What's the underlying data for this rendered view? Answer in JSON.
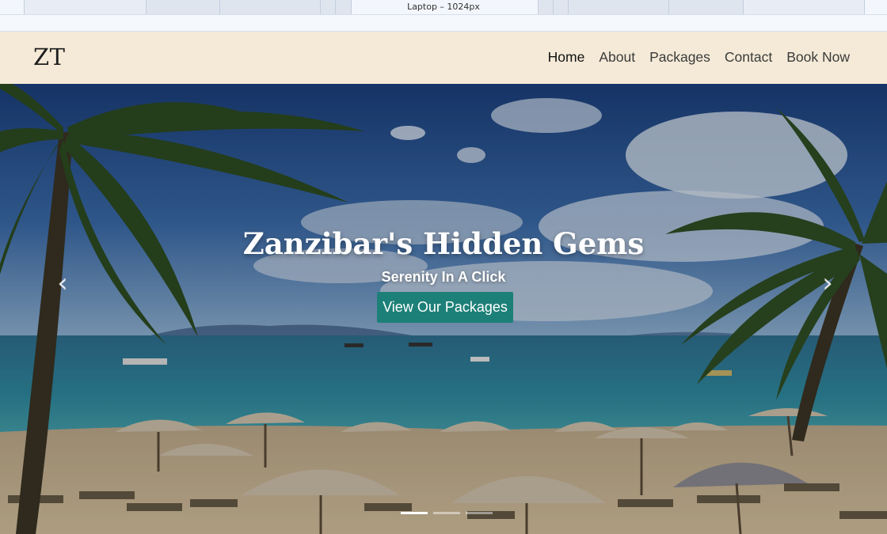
{
  "devtools": {
    "viewport_label": "Laptop – 1024px"
  },
  "navbar": {
    "logo": "ZT",
    "links": [
      {
        "label": "Home",
        "active": true
      },
      {
        "label": "About"
      },
      {
        "label": "Packages"
      },
      {
        "label": "Contact"
      },
      {
        "label": "Book Now"
      }
    ]
  },
  "hero": {
    "title": "Zanzibar's Hidden Gems",
    "subtitle": "Serenity In A Click",
    "cta_label": "View Our Packages",
    "prev_icon": "‹",
    "next_icon": "›",
    "indicators": [
      {
        "active": true
      },
      {
        "active": false
      },
      {
        "active": false
      }
    ],
    "background_image": "tropical beach with palm trees and umbrellas"
  },
  "colors": {
    "navbar_bg": "#f4ead7",
    "cta_bg": "#1d8078"
  }
}
